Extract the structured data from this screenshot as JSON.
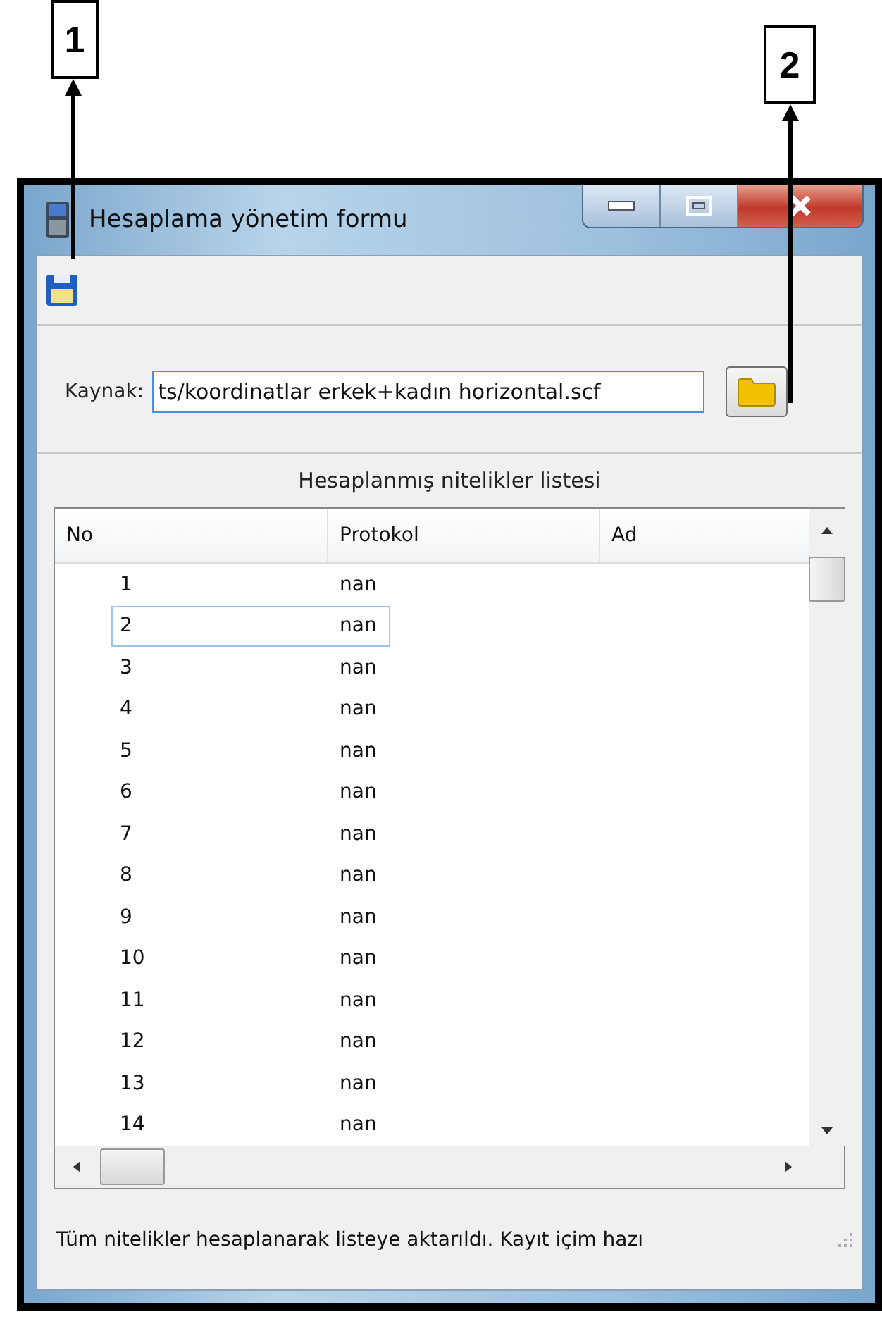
{
  "callouts": [
    {
      "label": "1"
    },
    {
      "label": "2"
    }
  ],
  "window": {
    "title": "Hesaplama yönetim formu"
  },
  "source": {
    "label": "Kaynak:",
    "value": "ts/koordinatlar erkek+kadın horizontal.scf"
  },
  "list_caption": "Hesaplanmış nitelikler listesi",
  "table": {
    "columns": [
      "No",
      "Protokol",
      "Ad"
    ],
    "rows": [
      {
        "no": "1",
        "protokol": "nan",
        "selected": false
      },
      {
        "no": "2",
        "protokol": "nan",
        "selected": true
      },
      {
        "no": "3",
        "protokol": "nan",
        "selected": false
      },
      {
        "no": "4",
        "protokol": "nan",
        "selected": false
      },
      {
        "no": "5",
        "protokol": "nan",
        "selected": false
      },
      {
        "no": "6",
        "protokol": "nan",
        "selected": false
      },
      {
        "no": "7",
        "protokol": "nan",
        "selected": false
      },
      {
        "no": "8",
        "protokol": "nan",
        "selected": false
      },
      {
        "no": "9",
        "protokol": "nan",
        "selected": false
      },
      {
        "no": "10",
        "protokol": "nan",
        "selected": false
      },
      {
        "no": "11",
        "protokol": "nan",
        "selected": false
      },
      {
        "no": "12",
        "protokol": "nan",
        "selected": false
      },
      {
        "no": "13",
        "protokol": "nan",
        "selected": false
      },
      {
        "no": "14",
        "protokol": "nan",
        "selected": false
      }
    ]
  },
  "status_bar": "Tüm nitelikler hesaplanarak listeye aktarıldı. Kayıt içim hazı"
}
